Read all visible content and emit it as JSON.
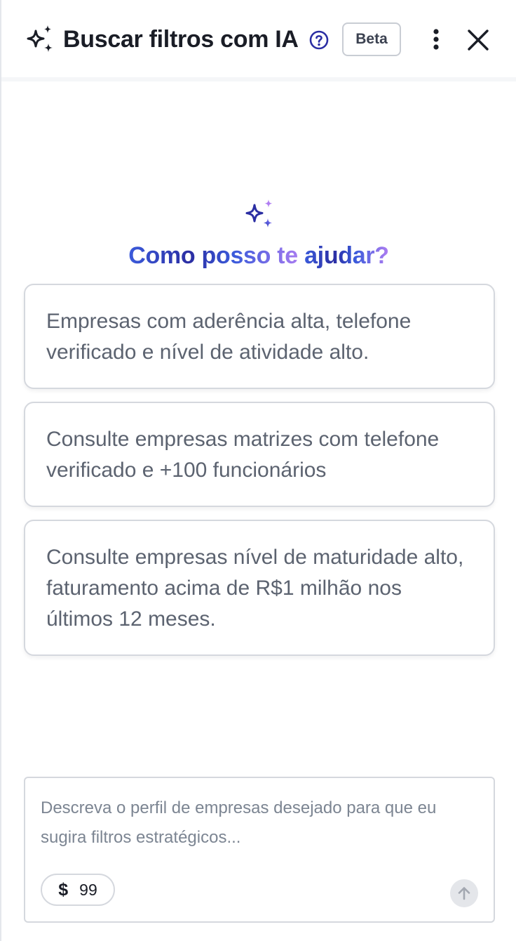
{
  "header": {
    "title": "Buscar filtros com IA",
    "beta_label": "Beta",
    "icons": [
      "sparkles-icon",
      "help-circle-icon",
      "more-vertical-icon",
      "close-icon"
    ]
  },
  "hero": {
    "title_part1": "Como posso te ",
    "title_part2": "ajudar?"
  },
  "suggestions": [
    "Empresas com aderência alta, telefone verificado e nível de atividade alto.",
    "Consulte empresas matrizes com telefone verificado e +100 funcionários",
    "Consulte empresas nível de maturidade alto, faturamento acima de R$1 milhão nos últimos 12 meses."
  ],
  "input": {
    "placeholder": "Descreva o perfil de empresas desejado para que eu sugira filtros estratégicos...",
    "value": "",
    "credits_symbol": "$",
    "credits": "99"
  },
  "colors": {
    "header_text": "#1a1d26",
    "help_icon": "#2b2ea3",
    "gradient_start": "#3b5bdb",
    "gradient_end": "#b07ef2",
    "card_text": "#5c6370",
    "placeholder": "#7c8592"
  }
}
